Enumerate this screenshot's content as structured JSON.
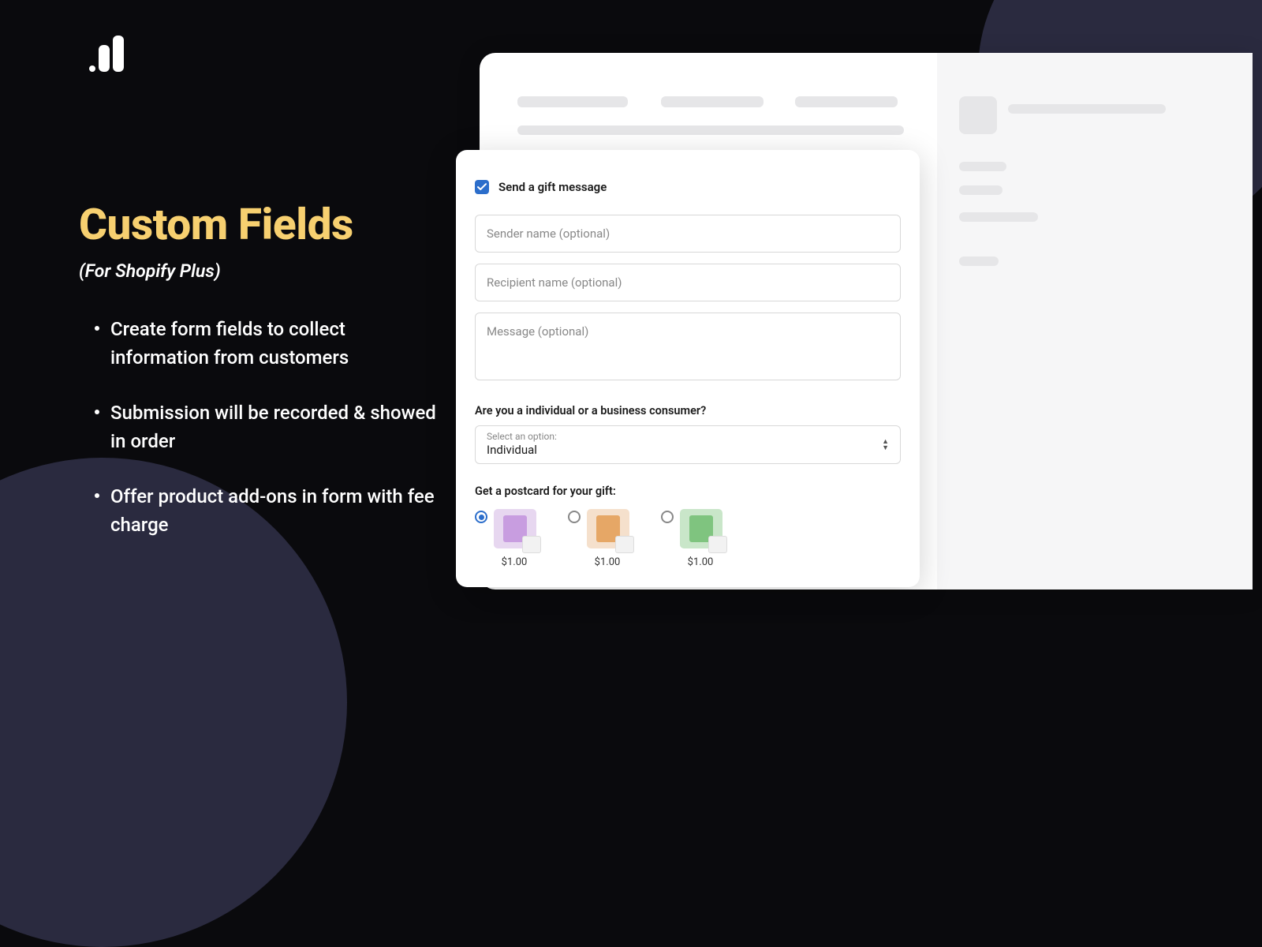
{
  "left": {
    "title": "Custom Fields",
    "subtitle": "(For Shopify Plus)",
    "bullets": [
      "Create form fields to collect information from customers",
      "Submission will be recorded & showed in order",
      "Offer product add-ons in form with fee charge"
    ]
  },
  "form": {
    "checkbox_label": "Send a gift message",
    "checkbox_checked": true,
    "sender_placeholder": "Sender name (optional)",
    "recipient_placeholder": "Recipient name (optional)",
    "message_placeholder": "Message (optional)",
    "consumer_question": "Are you a individual or a business consumer?",
    "select_hint": "Select an option:",
    "select_value": "Individual",
    "postcard_label": "Get a postcard for your gift:",
    "postcards": [
      {
        "price": "$1.00",
        "selected": true
      },
      {
        "price": "$1.00",
        "selected": false
      },
      {
        "price": "$1.00",
        "selected": false
      }
    ]
  }
}
